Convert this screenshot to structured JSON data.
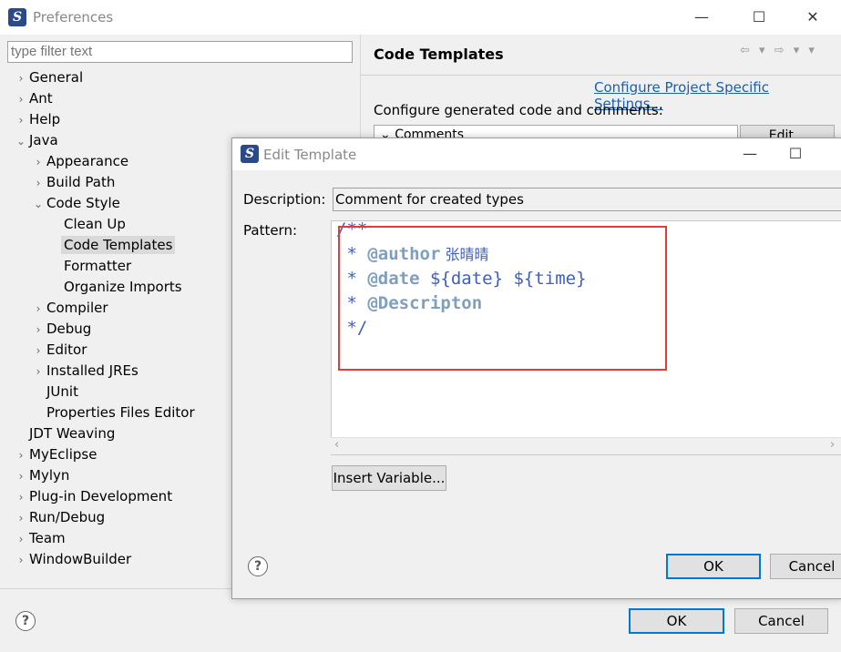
{
  "window": {
    "title": "Preferences",
    "minimize_icon": "minimize-icon",
    "maximize_icon": "maximize-icon",
    "close_icon": "close-icon"
  },
  "filter": {
    "placeholder": "type filter text"
  },
  "tree": [
    {
      "label": "General",
      "arrow": "›"
    },
    {
      "label": "Ant",
      "arrow": "›"
    },
    {
      "label": "Help",
      "arrow": "›"
    },
    {
      "label": "Java",
      "arrow": "⌄"
    },
    {
      "label": "Appearance",
      "arrow": "›"
    },
    {
      "label": "Build Path",
      "arrow": "›"
    },
    {
      "label": "Code Style",
      "arrow": "⌄"
    },
    {
      "label": "Clean Up",
      "arrow": ""
    },
    {
      "label": "Code Templates",
      "arrow": ""
    },
    {
      "label": "Formatter",
      "arrow": ""
    },
    {
      "label": "Organize Imports",
      "arrow": ""
    },
    {
      "label": "Compiler",
      "arrow": "›"
    },
    {
      "label": "Debug",
      "arrow": "›"
    },
    {
      "label": "Editor",
      "arrow": "›"
    },
    {
      "label": "Installed JREs",
      "arrow": "›"
    },
    {
      "label": "JUnit",
      "arrow": ""
    },
    {
      "label": "Properties Files Editor",
      "arrow": ""
    },
    {
      "label": "JDT Weaving",
      "arrow": ""
    },
    {
      "label": "MyEclipse",
      "arrow": "›"
    },
    {
      "label": "Mylyn",
      "arrow": "›"
    },
    {
      "label": "Plug-in Development",
      "arrow": "›"
    },
    {
      "label": "Run/Debug",
      "arrow": "›"
    },
    {
      "label": "Team",
      "arrow": "›"
    },
    {
      "label": "WindowBuilder",
      "arrow": "›"
    }
  ],
  "right": {
    "title": "Code Templates",
    "project_link": "Configure Project Specific Settings...",
    "configure_label": "Configure generated code and comments:",
    "comments_item": "Comments",
    "edit_button": "Edit..."
  },
  "footer": {
    "ok": "OK",
    "cancel": "Cancel"
  },
  "dialog": {
    "title": "Edit Template",
    "description_label": "Description:",
    "description_value": "Comment for created types",
    "pattern_label": "Pattern:",
    "pattern": {
      "line1": "/**",
      "line2_prefix": " * ",
      "line2_tag": "@author",
      "line2_text": " 张晴晴",
      "line3_prefix": " * ",
      "line3_tag": "@date",
      "line3_text": " ${date} ${time}",
      "line4_prefix": " * ",
      "line4_tag": "@Descripton",
      "line5": " */"
    },
    "insert_variable": "Insert Variable...",
    "ok": "OK",
    "cancel": "Cancel"
  },
  "colors": {
    "highlight_rect": "#e03c3c",
    "link": "#1a5fb4",
    "code": "#3f5fbf"
  }
}
